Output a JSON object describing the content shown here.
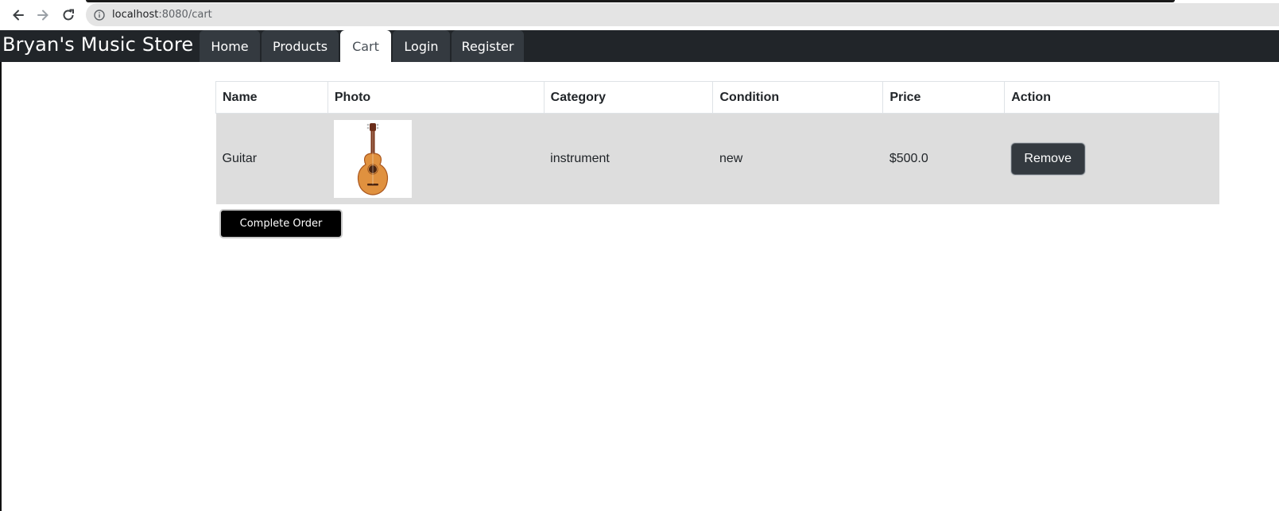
{
  "browser": {
    "url_host": "localhost",
    "url_rest": ":8080/cart",
    "back_icon": "arrow-left-icon",
    "forward_icon": "arrow-right-icon",
    "reload_icon": "reload-icon",
    "info_icon": "info-icon"
  },
  "header": {
    "brand": "Bryan's Music Store",
    "tabs": [
      {
        "label": "Home",
        "active": false
      },
      {
        "label": "Products",
        "active": false
      },
      {
        "label": "Cart",
        "active": true
      },
      {
        "label": "Login",
        "active": false
      },
      {
        "label": "Register",
        "active": false
      }
    ]
  },
  "cart": {
    "columns": [
      "Name",
      "Photo",
      "Category",
      "Condition",
      "Price",
      "Action"
    ],
    "rows": [
      {
        "name": "Guitar",
        "photo_icon": "acoustic-guitar-image",
        "category": "instrument",
        "condition": "new",
        "price": "$500.0",
        "action_label": "Remove"
      }
    ],
    "complete_label": "Complete Order"
  },
  "colors": {
    "navbar": "#212529",
    "tab": "#343a40",
    "row_bg": "#dddddd",
    "complete_button": "#000000"
  }
}
